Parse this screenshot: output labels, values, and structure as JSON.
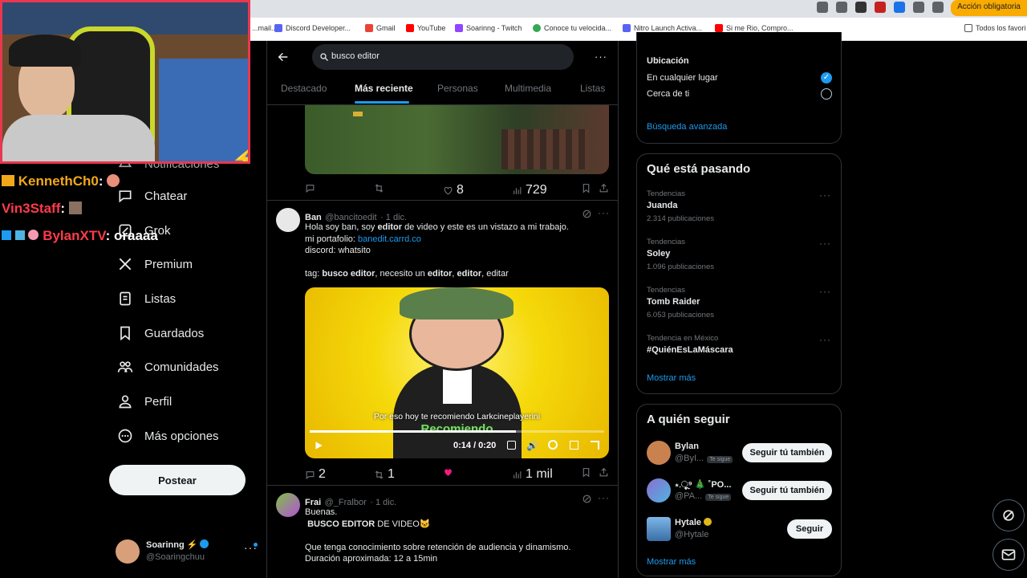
{
  "browser": {
    "action_button": "Acción obligatoria",
    "bookmarks": [
      {
        "label": "...mail...",
        "color": "#ea4335"
      },
      {
        "label": "Discord Developer...",
        "color": "#5865f2"
      },
      {
        "label": "Gmail",
        "color": "#ea4335"
      },
      {
        "label": "YouTube",
        "color": "#ff0000"
      },
      {
        "label": "Soarinng - Twitch",
        "color": "#9146ff"
      },
      {
        "label": "Conoce tu velocida...",
        "color": "#34a853"
      },
      {
        "label": "Nitro Launch Activa...",
        "color": "#5865f2"
      },
      {
        "label": "Si me Rio, Compro...",
        "color": "#ff0000"
      }
    ],
    "bookmarks_all": "Todos los favori"
  },
  "nav": {
    "items": [
      {
        "label": "Notificaciones",
        "icon": "bell-icon"
      },
      {
        "label": "Chatear",
        "icon": "chat-icon"
      },
      {
        "label": "Grok",
        "icon": "grok-icon"
      },
      {
        "label": "Premium",
        "icon": "x-logo-icon"
      },
      {
        "label": "Listas",
        "icon": "list-icon"
      },
      {
        "label": "Guardados",
        "icon": "bookmark-icon"
      },
      {
        "label": "Comunidades",
        "icon": "community-icon"
      },
      {
        "label": "Perfil",
        "icon": "user-icon"
      },
      {
        "label": "Más opciones",
        "icon": "more-circle-icon"
      }
    ],
    "post_button": "Postear",
    "profile": {
      "name": "Soarinng ⚡",
      "handle": "@Soaringchuu"
    }
  },
  "search": {
    "query": "busco editor",
    "tabs": [
      "Destacado",
      "Más reciente",
      "Personas",
      "Multimedia",
      "Listas"
    ],
    "active_tab": "Más reciente"
  },
  "tweets": [
    {
      "reply": "",
      "retweet": "",
      "likes": "8",
      "views": "729"
    },
    {
      "name": "Ban",
      "handle": "@bancitoedit",
      "date": "· 1 dic.",
      "line1_a": "Hola soy ban, soy ",
      "line1_b": "editor",
      "line1_c": " de video y este es un vistazo a mi trabajo.",
      "line2_a": "mi portafolio: ",
      "line2_link": "banedit.carrd.co",
      "line3": "discord: whatsito",
      "tag_a": "tag: ",
      "tag_b": "busco editor",
      "tag_c": ", necesito un ",
      "tag_d": "editor",
      "tag_e": ", ",
      "tag_f": "editor",
      "tag_g": ", editar",
      "video_caption": "Por eso hoy te recomiendo Larkcineplayerini",
      "video_overlay": "Recomiendo",
      "video_time": "0:14 / 0:20",
      "video_progress": 0.7,
      "reply": "2",
      "retweet": "1",
      "likes": "",
      "views": "1 mil"
    },
    {
      "name": "Frai",
      "handle": "@_Fralbor",
      "date": "· 1 dic.",
      "line1": "Buenas.",
      "line2_a": "BUSCO EDITOR",
      "line2_b": " DE VIDEO🐱",
      "line3": "Que tenga conocimiento sobre retención de audiencia y dinamismo.",
      "line4": "Duración aproximada: 12 a 15min"
    }
  ],
  "filters": {
    "title": "Ubicación",
    "options": [
      {
        "label": "En cualquier lugar",
        "checked": true
      },
      {
        "label": "Cerca de ti",
        "checked": false
      }
    ],
    "advanced": "Búsqueda avanzada"
  },
  "trends": {
    "title": "Qué está pasando",
    "items": [
      {
        "category": "Tendencias",
        "name": "Juanda",
        "count": "2.314 publicaciones"
      },
      {
        "category": "Tendencias",
        "name": "Soley",
        "count": "1.096 publicaciones"
      },
      {
        "category": "Tendencias",
        "name": "Tomb Raider",
        "count": "6.053 publicaciones"
      },
      {
        "category": "Tendencia en México",
        "name": "#QuiénEsLaMáscara",
        "count": ""
      }
    ],
    "show_more": "Mostrar más"
  },
  "who_to_follow": {
    "title": "A quién seguir",
    "users": [
      {
        "name": "Bylan",
        "handle": "@ByI...",
        "badge": "Te sigue",
        "button": "Seguir tú también"
      },
      {
        "name": "⋆.ૂ⁹ 🎄 ˚PO...",
        "handle": "@PA...",
        "badge": "Te sigue",
        "button": "Seguir tú también"
      },
      {
        "name": "Hytale",
        "handle": "@Hytale",
        "badge": "",
        "button": "Seguir"
      }
    ],
    "show_more": "Mostrar más"
  },
  "chat": [
    {
      "user": "KennethCh0",
      "message": ":",
      "color": "#f2a81b"
    },
    {
      "user": "Vin3Staff",
      "message": ":",
      "color": "#ff3b4a"
    },
    {
      "user": "BylanXTV",
      "message": ": oraaaa",
      "color": "#ff3b4a"
    }
  ]
}
